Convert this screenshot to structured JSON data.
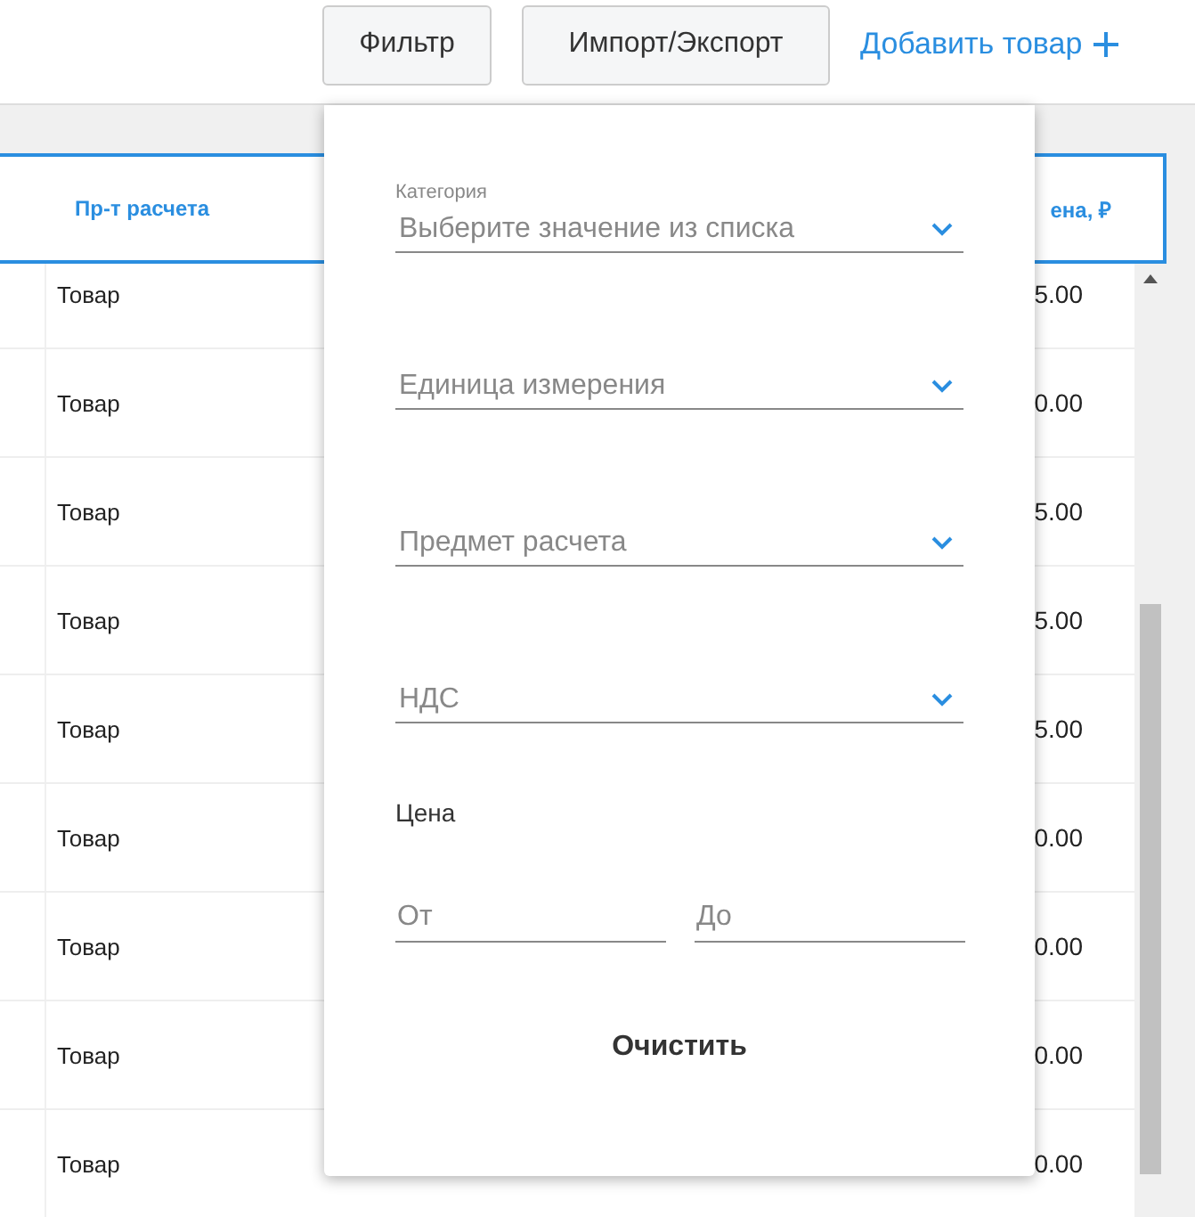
{
  "toolbar": {
    "buttons": [
      {
        "label": "Фильтр"
      },
      {
        "label": "Импорт/Экспорт"
      }
    ],
    "add_link": "Добавить товар"
  },
  "table": {
    "columns": [
      {
        "label": "Пр-т расчета"
      },
      {
        "label": "ена, ₽"
      }
    ],
    "rows": [
      {
        "type": "Товар",
        "price": "5.00"
      },
      {
        "type": "Товар",
        "price": "0.00"
      },
      {
        "type": "Товар",
        "price": "5.00"
      },
      {
        "type": "Товар",
        "price": "5.00"
      },
      {
        "type": "Товар",
        "price": "5.00"
      },
      {
        "type": "Товар",
        "price": "0.00"
      },
      {
        "type": "Товар",
        "price": "0.00"
      },
      {
        "type": "Товар",
        "price": "0.00"
      },
      {
        "type": "Товар",
        "price": "0.00"
      }
    ]
  },
  "filter_panel": {
    "selects": [
      {
        "label": "Категория",
        "placeholder": "Выберите значение из списка"
      },
      {
        "placeholder": "Единица измерения"
      },
      {
        "placeholder": "Предмет расчета"
      },
      {
        "placeholder": "НДС"
      }
    ],
    "price": {
      "label": "Цена",
      "from": {
        "placeholder": "От"
      },
      "to": {
        "placeholder": "До"
      }
    },
    "clear_button": "Очистить"
  }
}
